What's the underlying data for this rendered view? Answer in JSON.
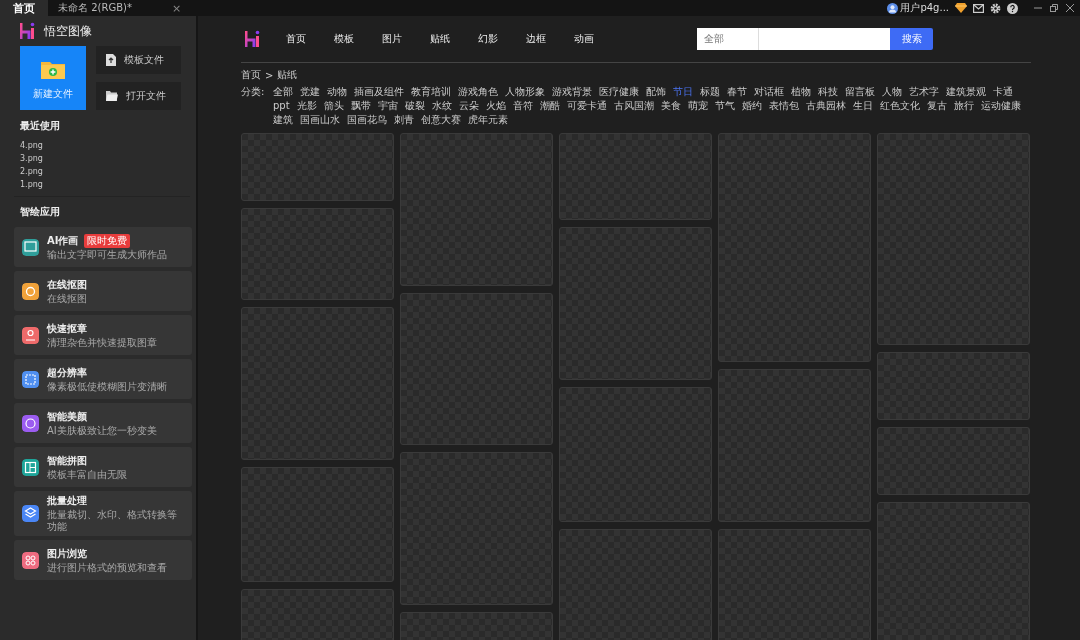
{
  "title_bar": {
    "tabs": [
      {
        "label": "首页",
        "selected": true,
        "closable": false
      },
      {
        "label": "未命名 2(RGB)*",
        "selected": false,
        "closable": true
      }
    ],
    "close_tab_glyph": "×",
    "user": "用户p4g..."
  },
  "sidebar": {
    "app_name": "悟空图像",
    "new_file": "新建文件",
    "template_file": "模板文件",
    "open_file": "打开文件",
    "recent_title": "最近使用",
    "recent_files": [
      "4.png",
      "3.png",
      "2.png",
      "1.png"
    ],
    "apps_title": "智绘应用",
    "apps": [
      {
        "name": "AI作画",
        "badge": "限时免费",
        "desc": "输出文字即可生成大师作品",
        "color": "#2f9e9a"
      },
      {
        "name": "在线抠图",
        "desc": "在线抠图",
        "color": "#f0a23a"
      },
      {
        "name": "快速抠章",
        "desc": "清理杂色并快速提取图章",
        "color": "#ee6a6a"
      },
      {
        "name": "超分辨率",
        "desc": "像素极低使模糊图片变清晰",
        "color": "#4f8ff0"
      },
      {
        "name": "智能美颜",
        "desc": "AI美肤极致让您一秒变美",
        "color": "#9b5cf0"
      },
      {
        "name": "智能拼图",
        "desc": "模板丰富自由无限",
        "color": "#1fa59a"
      },
      {
        "name": "批量处理",
        "desc": "批量裁切、水印、格式转换等功能",
        "color": "#4a86f5"
      },
      {
        "name": "图片浏览",
        "desc": "进行图片格式的预览和查看",
        "color": "#ee6b80"
      }
    ]
  },
  "nav": {
    "items": [
      "首页",
      "模板",
      "图片",
      "贴纸",
      "幻影",
      "边框",
      "动画"
    ],
    "search": {
      "scope": "全部",
      "button": "搜索"
    }
  },
  "breadcrumb": {
    "items": [
      "首页",
      "贴纸"
    ],
    "separator": ">"
  },
  "categories": {
    "label": "分类:",
    "items": [
      {
        "label": "全部",
        "selected": false
      },
      {
        "label": "党建",
        "selected": false
      },
      {
        "label": "动物",
        "selected": false
      },
      {
        "label": "插画及组件",
        "selected": false
      },
      {
        "label": "教育培训",
        "selected": false
      },
      {
        "label": "游戏角色",
        "selected": false
      },
      {
        "label": "人物形象",
        "selected": false
      },
      {
        "label": "游戏背景",
        "selected": false
      },
      {
        "label": "医疗健康",
        "selected": false
      },
      {
        "label": "配饰",
        "selected": false
      },
      {
        "label": "节日",
        "selected": true
      },
      {
        "label": "标题",
        "selected": false
      },
      {
        "label": "春节",
        "selected": false
      },
      {
        "label": "对话框",
        "selected": false
      },
      {
        "label": "植物",
        "selected": false
      },
      {
        "label": "科技",
        "selected": false
      },
      {
        "label": "留言板",
        "selected": false
      },
      {
        "label": "人物",
        "selected": false
      },
      {
        "label": "艺术字",
        "selected": false
      },
      {
        "label": "建筑景观",
        "selected": false
      },
      {
        "label": "卡通",
        "selected": false
      },
      {
        "label": "ppt",
        "selected": false
      },
      {
        "label": "光影",
        "selected": false
      },
      {
        "label": "箭头",
        "selected": false
      },
      {
        "label": "飘带",
        "selected": false
      },
      {
        "label": "宇宙",
        "selected": false
      },
      {
        "label": "破裂",
        "selected": false
      },
      {
        "label": "水纹",
        "selected": false
      },
      {
        "label": "云朵",
        "selected": false
      },
      {
        "label": "火焰",
        "selected": false
      },
      {
        "label": "音符",
        "selected": false
      },
      {
        "label": "潮酷",
        "selected": false
      },
      {
        "label": "可爱卡通",
        "selected": false
      },
      {
        "label": "古风国潮",
        "selected": false
      },
      {
        "label": "美食",
        "selected": false
      },
      {
        "label": "萌宠",
        "selected": false
      },
      {
        "label": "节气",
        "selected": false
      },
      {
        "label": "婚约",
        "selected": false
      },
      {
        "label": "表情包",
        "selected": false
      },
      {
        "label": "古典园林",
        "selected": false
      },
      {
        "label": "生日",
        "selected": false
      },
      {
        "label": "红色文化",
        "selected": false
      },
      {
        "label": "复古",
        "selected": false
      },
      {
        "label": "旅行",
        "selected": false
      },
      {
        "label": "运动健康",
        "selected": false
      },
      {
        "label": "建筑",
        "selected": false
      },
      {
        "label": "国画山水",
        "selected": false
      },
      {
        "label": "国画花鸟",
        "selected": false
      },
      {
        "label": "刺青",
        "selected": false
      },
      {
        "label": "创意大赛",
        "selected": false
      },
      {
        "label": "虎年元素",
        "selected": false
      }
    ]
  }
}
